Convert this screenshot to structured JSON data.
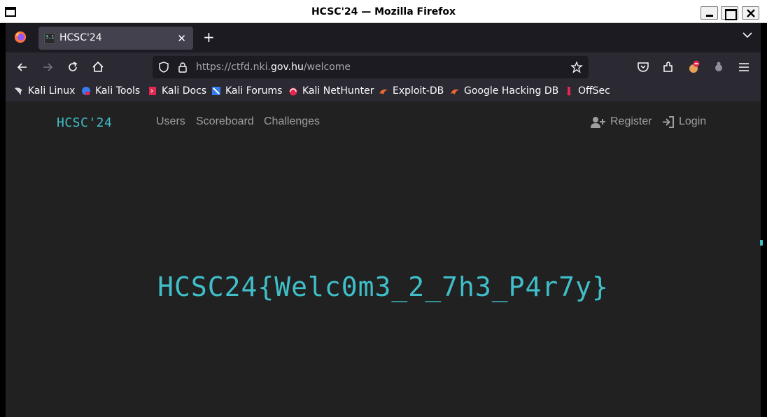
{
  "window": {
    "title": "HCSC'24 — Mozilla Firefox"
  },
  "browser": {
    "tab": {
      "title": "HCSC'24"
    },
    "url": {
      "prefix": "https://ctfd.nki.",
      "host": "gov.hu",
      "path": "/welcome"
    },
    "bookmarks": [
      {
        "label": "Kali Linux",
        "icon": "kali-dragon-icon"
      },
      {
        "label": "Kali Tools",
        "icon": "kali-tools-icon"
      },
      {
        "label": "Kali Docs",
        "icon": "kali-docs-icon"
      },
      {
        "label": "Kali Forums",
        "icon": "kali-forums-icon"
      },
      {
        "label": "Kali NetHunter",
        "icon": "nethunter-icon"
      },
      {
        "label": "Exploit-DB",
        "icon": "exploit-db-icon"
      },
      {
        "label": "Google Hacking DB",
        "icon": "ghdb-icon"
      },
      {
        "label": "OffSec",
        "icon": "offsec-icon"
      }
    ]
  },
  "site": {
    "brand": "HCSC'24",
    "nav": [
      "Users",
      "Scoreboard",
      "Challenges"
    ],
    "register": "Register",
    "login": "Login",
    "flag": "HCSC24{Welc0m3_2_7h3_P4r7y}",
    "accent": "#3fbfc9"
  }
}
